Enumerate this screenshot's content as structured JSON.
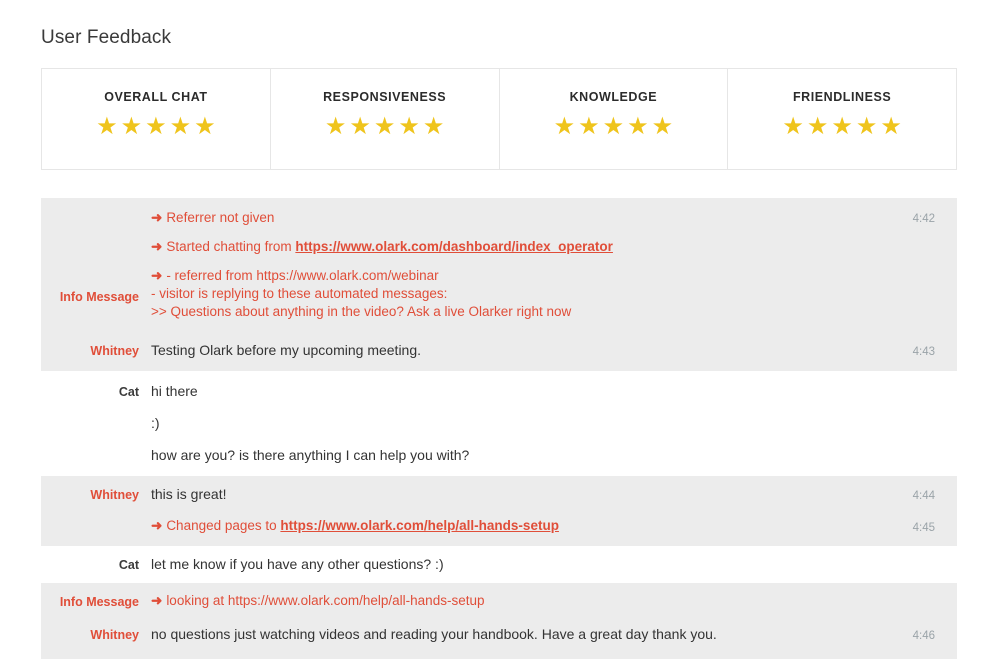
{
  "page": {
    "title": "User Feedback"
  },
  "ratings": {
    "max_stars": 5,
    "star_glyph": "★",
    "star_color": "#EFC41C",
    "cards": [
      {
        "label": "OVERALL CHAT",
        "stars": 5
      },
      {
        "label": "RESPONSIVENESS",
        "stars": 5
      },
      {
        "label": "KNOWLEDGE",
        "stars": 5
      },
      {
        "label": "FRIENDLINESS",
        "stars": 5
      }
    ]
  },
  "transcript": {
    "arrow_glyph": "➜",
    "colors": {
      "accent": "#E04E39",
      "shaded_row": "#ECECEC",
      "timestamp": "#9AA3A8"
    },
    "rows": [
      {
        "speaker": "Info Message",
        "speaker_type": "info",
        "shaded": true,
        "timestamps": [
          "4:42"
        ],
        "lines": [
          {
            "text": "Referrer not given",
            "arrow": true,
            "info": true
          },
          {
            "prefix": "Started chatting from ",
            "arrow": true,
            "info": true,
            "link": "https://www.olark.com/dashboard/index_operator"
          },
          {
            "text": "- referred from https://www.olark.com/webinar",
            "arrow": true,
            "info": true
          },
          {
            "text": "- visitor is replying to these automated messages:",
            "arrow": false,
            "info": true
          },
          {
            "text": ">> Questions about anything in the video? Ask a live Olarker right now",
            "arrow": false,
            "info": true
          }
        ]
      },
      {
        "speaker": "Whitney",
        "speaker_type": "visitor",
        "shaded": true,
        "timestamps": [
          "4:43"
        ],
        "lines": [
          {
            "text": "Testing Olark before my upcoming meeting.",
            "arrow": false,
            "info": false
          }
        ]
      },
      {
        "speaker": "Cat",
        "speaker_type": "operator",
        "shaded": false,
        "timestamps": [],
        "lines": [
          {
            "text": "hi there",
            "arrow": false,
            "info": false
          },
          {
            "text": ":)",
            "arrow": false,
            "info": false
          },
          {
            "text": "how are you? is there anything I can help you with?",
            "arrow": false,
            "info": false
          }
        ]
      },
      {
        "speaker": "Whitney",
        "speaker_type": "visitor",
        "shaded": true,
        "timestamps": [
          "4:44",
          "4:45"
        ],
        "lines": [
          {
            "text": "this is great!",
            "arrow": false,
            "info": false
          },
          {
            "prefix": "Changed pages to ",
            "arrow": true,
            "info": true,
            "link": "https://www.olark.com/help/all-hands-setup"
          }
        ]
      },
      {
        "speaker": "Cat",
        "speaker_type": "operator",
        "shaded": false,
        "timestamps": [],
        "lines": [
          {
            "text": "let me know if you have any other questions? :)",
            "arrow": false,
            "info": false
          }
        ]
      },
      {
        "speaker": "Info Message",
        "speaker_type": "info",
        "shaded": true,
        "timestamps": [],
        "lines": [
          {
            "text": "looking at https://www.olark.com/help/all-hands-setup",
            "arrow": true,
            "info": true
          }
        ]
      },
      {
        "speaker": "Whitney",
        "speaker_type": "visitor",
        "shaded": true,
        "timestamps": [
          "4:46"
        ],
        "lines": [
          {
            "text": "no questions just watching videos and reading your handbook. Have a great day thank you.",
            "arrow": false,
            "info": false
          }
        ]
      }
    ]
  }
}
